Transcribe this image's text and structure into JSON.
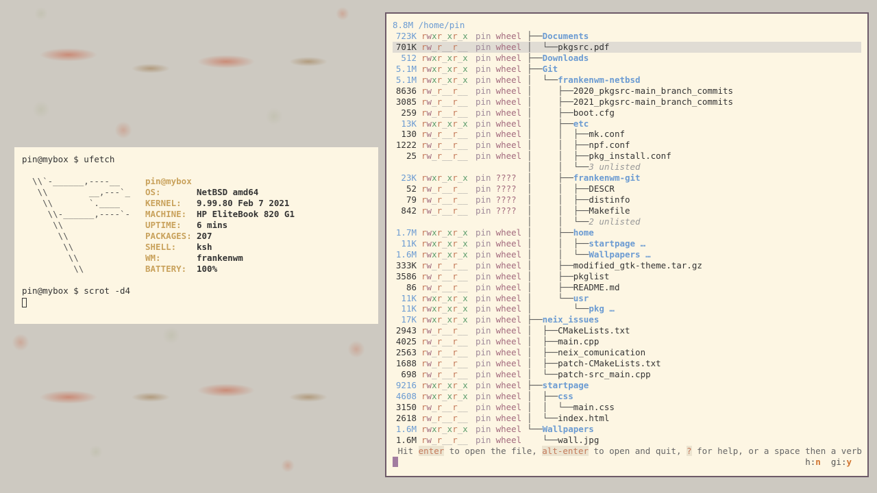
{
  "terminal": {
    "prompt1": "pin@mybox $ ufetch",
    "logo": [
      "  \\\\`-______,----__",
      "   \\\\        __,---`_",
      "    \\\\       `.____",
      "     \\\\-______,----`-",
      "      \\\\",
      "       \\\\",
      "        \\\\",
      "         \\\\",
      "          \\\\"
    ],
    "user_host": "pin@mybox",
    "info": [
      {
        "key": "OS:",
        "value": "NetBSD amd64"
      },
      {
        "key": "KERNEL:",
        "value": "9.99.80 Feb 7 2021"
      },
      {
        "key": "MACHINE:",
        "value": "HP EliteBook 820 G1"
      },
      {
        "key": "UPTIME:",
        "value": "6 mins"
      },
      {
        "key": "PACKAGES:",
        "value": "207"
      },
      {
        "key": "SHELL:",
        "value": "ksh"
      },
      {
        "key": "WM:",
        "value": "frankenwm"
      },
      {
        "key": "BATTERY:",
        "value": "100%"
      }
    ],
    "prompt2": "pin@mybox $ scrot -d4"
  },
  "broot": {
    "header": "8.8M /home/pin",
    "rows": [
      {
        "size": "723K",
        "dir": true,
        "perm": "rwxr_xr_x",
        "owner": "pin",
        "group": "wheel",
        "indent": "├──",
        "name": "Documents",
        "kind": "dir"
      },
      {
        "size": "701K",
        "dir": false,
        "perm": "rw_r__r__",
        "owner": "pin",
        "group": "wheel",
        "indent": "│  └──",
        "name": "pkgsrc.pdf",
        "kind": "file",
        "selected": true
      },
      {
        "size": "512",
        "dir": true,
        "perm": "rwxr_xr_x",
        "owner": "pin",
        "group": "wheel",
        "indent": "├──",
        "name": "Downloads",
        "kind": "dir"
      },
      {
        "size": "5.1M",
        "dir": true,
        "perm": "rwxr_xr_x",
        "owner": "pin",
        "group": "wheel",
        "indent": "├──",
        "name": "Git",
        "kind": "dir"
      },
      {
        "size": "5.1M",
        "dir": true,
        "perm": "rwxr_xr_x",
        "owner": "pin",
        "group": "wheel",
        "indent": "│  └──",
        "name": "frankenwm-netbsd",
        "kind": "dir"
      },
      {
        "size": "8636",
        "dir": false,
        "perm": "rw_r__r__",
        "owner": "pin",
        "group": "wheel",
        "indent": "│     ├──",
        "name": "2020_pkgsrc-main_branch_commits",
        "kind": "file"
      },
      {
        "size": "3085",
        "dir": false,
        "perm": "rw_r__r__",
        "owner": "pin",
        "group": "wheel",
        "indent": "│     ├──",
        "name": "2021_pkgsrc-main_branch_commits",
        "kind": "file"
      },
      {
        "size": "259",
        "dir": false,
        "perm": "rw_r__r__",
        "owner": "pin",
        "group": "wheel",
        "indent": "│     ├──",
        "name": "boot.cfg",
        "kind": "file"
      },
      {
        "size": "13K",
        "dir": true,
        "perm": "rwxr_xr_x",
        "owner": "pin",
        "group": "wheel",
        "indent": "│     ├──",
        "name": "etc",
        "kind": "dir"
      },
      {
        "size": "130",
        "dir": false,
        "perm": "rw_r__r__",
        "owner": "pin",
        "group": "wheel",
        "indent": "│     │  ├──",
        "name": "mk.conf",
        "kind": "file"
      },
      {
        "size": "1222",
        "dir": false,
        "perm": "rw_r__r__",
        "owner": "pin",
        "group": "wheel",
        "indent": "│     │  ├──",
        "name": "npf.conf",
        "kind": "file"
      },
      {
        "size": "25",
        "dir": false,
        "perm": "rw_r__r__",
        "owner": "pin",
        "group": "wheel",
        "indent": "│     │  ├──",
        "name": "pkg_install.conf",
        "kind": "file"
      },
      {
        "size": "",
        "dir": false,
        "perm": "",
        "owner": "",
        "group": "",
        "indent": "│     │  └──",
        "name": "3 unlisted",
        "kind": "unlisted"
      },
      {
        "size": "23K",
        "dir": true,
        "perm": "rwxr_xr_x",
        "owner": "pin",
        "group": "????",
        "indent": "│     ├──",
        "name": "frankenwm-git",
        "kind": "dir"
      },
      {
        "size": "52",
        "dir": false,
        "perm": "rw_r__r__",
        "owner": "pin",
        "group": "????",
        "indent": "│     │  ├──",
        "name": "DESCR",
        "kind": "file"
      },
      {
        "size": "79",
        "dir": false,
        "perm": "rw_r__r__",
        "owner": "pin",
        "group": "????",
        "indent": "│     │  ├──",
        "name": "distinfo",
        "kind": "file"
      },
      {
        "size": "842",
        "dir": false,
        "perm": "rw_r__r__",
        "owner": "pin",
        "group": "????",
        "indent": "│     │  ├──",
        "name": "Makefile",
        "kind": "file"
      },
      {
        "size": "",
        "dir": false,
        "perm": "",
        "owner": "",
        "group": "",
        "indent": "│     │  └──",
        "name": "2 unlisted",
        "kind": "unlisted"
      },
      {
        "size": "1.7M",
        "dir": true,
        "perm": "rwxr_xr_x",
        "owner": "pin",
        "group": "wheel",
        "indent": "│     ├──",
        "name": "home",
        "kind": "dir"
      },
      {
        "size": "11K",
        "dir": true,
        "perm": "rwxr_xr_x",
        "owner": "pin",
        "group": "wheel",
        "indent": "│     │  ├──",
        "name": "startpage …",
        "kind": "dir"
      },
      {
        "size": "1.6M",
        "dir": true,
        "perm": "rwxr_xr_x",
        "owner": "pin",
        "group": "wheel",
        "indent": "│     │  └──",
        "name": "Wallpapers …",
        "kind": "dir"
      },
      {
        "size": "333K",
        "dir": false,
        "perm": "rw_r__r__",
        "owner": "pin",
        "group": "wheel",
        "indent": "│     ├──",
        "name": "modified_gtk-theme.tar.gz",
        "kind": "file"
      },
      {
        "size": "3586",
        "dir": false,
        "perm": "rw_r__r__",
        "owner": "pin",
        "group": "wheel",
        "indent": "│     ├──",
        "name": "pkglist",
        "kind": "file"
      },
      {
        "size": "86",
        "dir": false,
        "perm": "rw_r__r__",
        "owner": "pin",
        "group": "wheel",
        "indent": "│     ├──",
        "name": "README.md",
        "kind": "file"
      },
      {
        "size": "11K",
        "dir": true,
        "perm": "rwxr_xr_x",
        "owner": "pin",
        "group": "wheel",
        "indent": "│     └──",
        "name": "usr",
        "kind": "dir"
      },
      {
        "size": "11K",
        "dir": true,
        "perm": "rwxr_xr_x",
        "owner": "pin",
        "group": "wheel",
        "indent": "│        └──",
        "name": "pkg …",
        "kind": "dir"
      },
      {
        "size": "17K",
        "dir": true,
        "perm": "rwxr_xr_x",
        "owner": "pin",
        "group": "wheel",
        "indent": "├──",
        "name": "neix_issues",
        "kind": "dir"
      },
      {
        "size": "2943",
        "dir": false,
        "perm": "rw_r__r__",
        "owner": "pin",
        "group": "wheel",
        "indent": "│  ├──",
        "name": "CMakeLists.txt",
        "kind": "file"
      },
      {
        "size": "4025",
        "dir": false,
        "perm": "rw_r__r__",
        "owner": "pin",
        "group": "wheel",
        "indent": "│  ├──",
        "name": "main.cpp",
        "kind": "file"
      },
      {
        "size": "2563",
        "dir": false,
        "perm": "rw_r__r__",
        "owner": "pin",
        "group": "wheel",
        "indent": "│  ├──",
        "name": "neix_comunication",
        "kind": "file"
      },
      {
        "size": "1688",
        "dir": false,
        "perm": "rw_r__r__",
        "owner": "pin",
        "group": "wheel",
        "indent": "│  ├──",
        "name": "patch-CMakeLists.txt",
        "kind": "file"
      },
      {
        "size": "698",
        "dir": false,
        "perm": "rw_r__r__",
        "owner": "pin",
        "group": "wheel",
        "indent": "│  └──",
        "name": "patch-src_main.cpp",
        "kind": "file"
      },
      {
        "size": "9216",
        "dir": true,
        "perm": "rwxr_xr_x",
        "owner": "pin",
        "group": "wheel",
        "indent": "├──",
        "name": "startpage",
        "kind": "dir"
      },
      {
        "size": "4608",
        "dir": true,
        "perm": "rwxr_xr_x",
        "owner": "pin",
        "group": "wheel",
        "indent": "│  ├──",
        "name": "css",
        "kind": "dir"
      },
      {
        "size": "3150",
        "dir": false,
        "perm": "rw_r__r__",
        "owner": "pin",
        "group": "wheel",
        "indent": "│  │  └──",
        "name": "main.css",
        "kind": "file"
      },
      {
        "size": "2618",
        "dir": false,
        "perm": "rw_r__r__",
        "owner": "pin",
        "group": "wheel",
        "indent": "│  └──",
        "name": "index.html",
        "kind": "file"
      },
      {
        "size": "1.6M",
        "dir": true,
        "perm": "rwxr_xr_x",
        "owner": "pin",
        "group": "wheel",
        "indent": "└──",
        "name": "Wallpapers",
        "kind": "dir"
      },
      {
        "size": "1.6M",
        "dir": false,
        "perm": "rw_r__r__",
        "owner": "pin",
        "group": "wheel",
        "indent": "   └──",
        "name": "wall.jpg",
        "kind": "file"
      }
    ],
    "status": {
      "p1": " Hit ",
      "k1": "enter",
      "p2": " to open the file, ",
      "k2": "alt-enter",
      "p3": " to open and quit, ",
      "k3": "?",
      "p4": " for help, or a space then a verb"
    },
    "flags": {
      "h_label": "h:",
      "h_value": "n",
      "gi_label": "gi:",
      "gi_value": "y"
    }
  },
  "colors": {
    "dir": "#6b9bd2",
    "accent": "#c9a25c",
    "selection": "#e0dcd4",
    "frame": "#6d5a68"
  }
}
